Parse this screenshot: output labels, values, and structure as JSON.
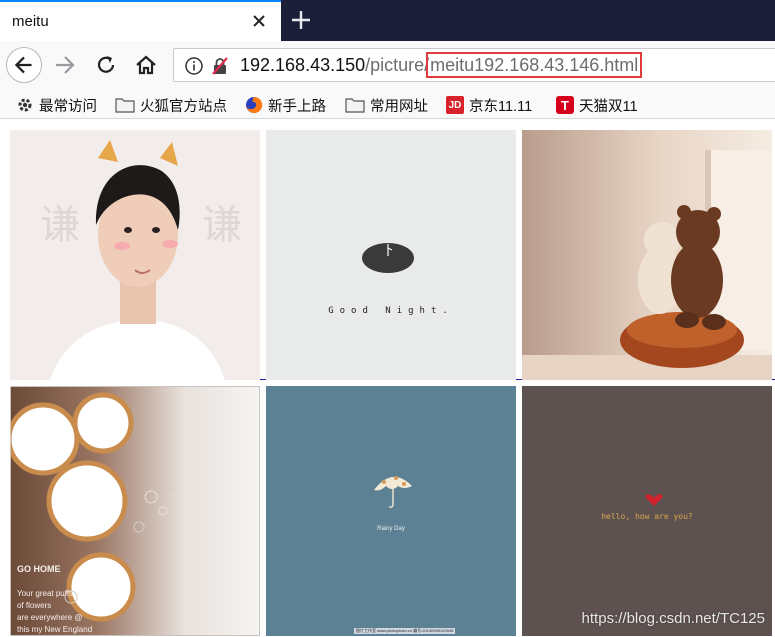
{
  "tab": {
    "title": "meitu"
  },
  "address": {
    "host": "192.168.43.150",
    "path": "/picture/",
    "highlighted": "meitu192.168.43.146.html"
  },
  "bookmarks": [
    {
      "label": "最常访问",
      "icon": "gear-icon"
    },
    {
      "label": "火狐官方站点",
      "icon": "folder-icon"
    },
    {
      "label": "新手上路",
      "icon": "firefox-icon"
    },
    {
      "label": "常用网址",
      "icon": "folder-icon"
    },
    {
      "label": "京东11.11",
      "icon": "jd-icon",
      "icon_text": "JD"
    },
    {
      "label": "天猫双11",
      "icon": "tmall-icon",
      "icon_text": "T"
    }
  ],
  "pictures": {
    "p1": {
      "glyph_left": "谦",
      "glyph_right": "谦"
    },
    "p2": {
      "caption": "Good Night."
    },
    "p4": {
      "title": "GO HOME",
      "lines": [
        "Your great puffs",
        "of flowers",
        "are everywhere @",
        "this my New England"
      ]
    },
    "p5": {
      "caption": "Rainy Day",
      "credit": "图片工作室 www.photophoto.cn 编号:20130909120045"
    },
    "p6": {
      "caption": "hello, how are you?"
    }
  },
  "watermark": "https://blog.csdn.net/TC125",
  "colors": {
    "tab_accent": "#0a84ff",
    "highlight_box": "#e23b3b",
    "tab_strip": "#1b1f3a"
  }
}
